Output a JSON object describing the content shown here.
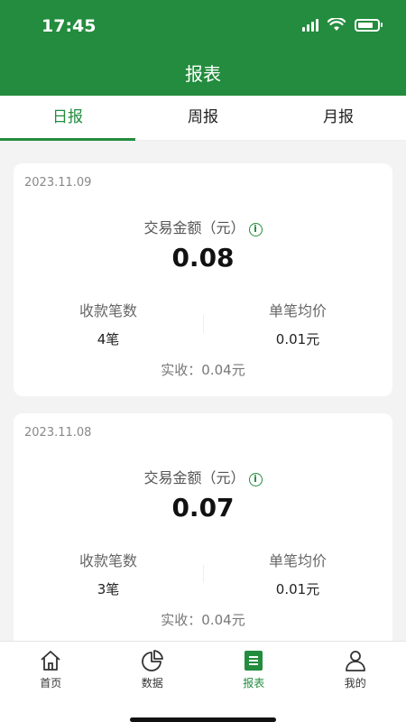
{
  "status_bar": {
    "time": "17:45"
  },
  "header": {
    "title": "报表"
  },
  "tabs": [
    {
      "label": "日报",
      "active": true
    },
    {
      "label": "周报",
      "active": false
    },
    {
      "label": "月报",
      "active": false
    }
  ],
  "reports": [
    {
      "date": "2023.11.09",
      "amount_label": "交易金额（元）",
      "amount": "0.08",
      "count_label": "收款笔数",
      "count_value": "4笔",
      "avg_label": "单笔均价",
      "avg_value": "0.01元",
      "actual": "实收：0.04元"
    },
    {
      "date": "2023.11.08",
      "amount_label": "交易金额（元）",
      "amount": "0.07",
      "count_label": "收款笔数",
      "count_value": "3笔",
      "avg_label": "单笔均价",
      "avg_value": "0.01元",
      "actual": "实收：0.04元"
    }
  ],
  "bottom_nav": [
    {
      "label": "首页",
      "icon": "home-icon"
    },
    {
      "label": "数据",
      "icon": "pie-chart-icon"
    },
    {
      "label": "报表",
      "icon": "report-icon",
      "active": true
    },
    {
      "label": "我的",
      "icon": "user-icon"
    }
  ],
  "colors": {
    "primary": "#238C3E"
  }
}
